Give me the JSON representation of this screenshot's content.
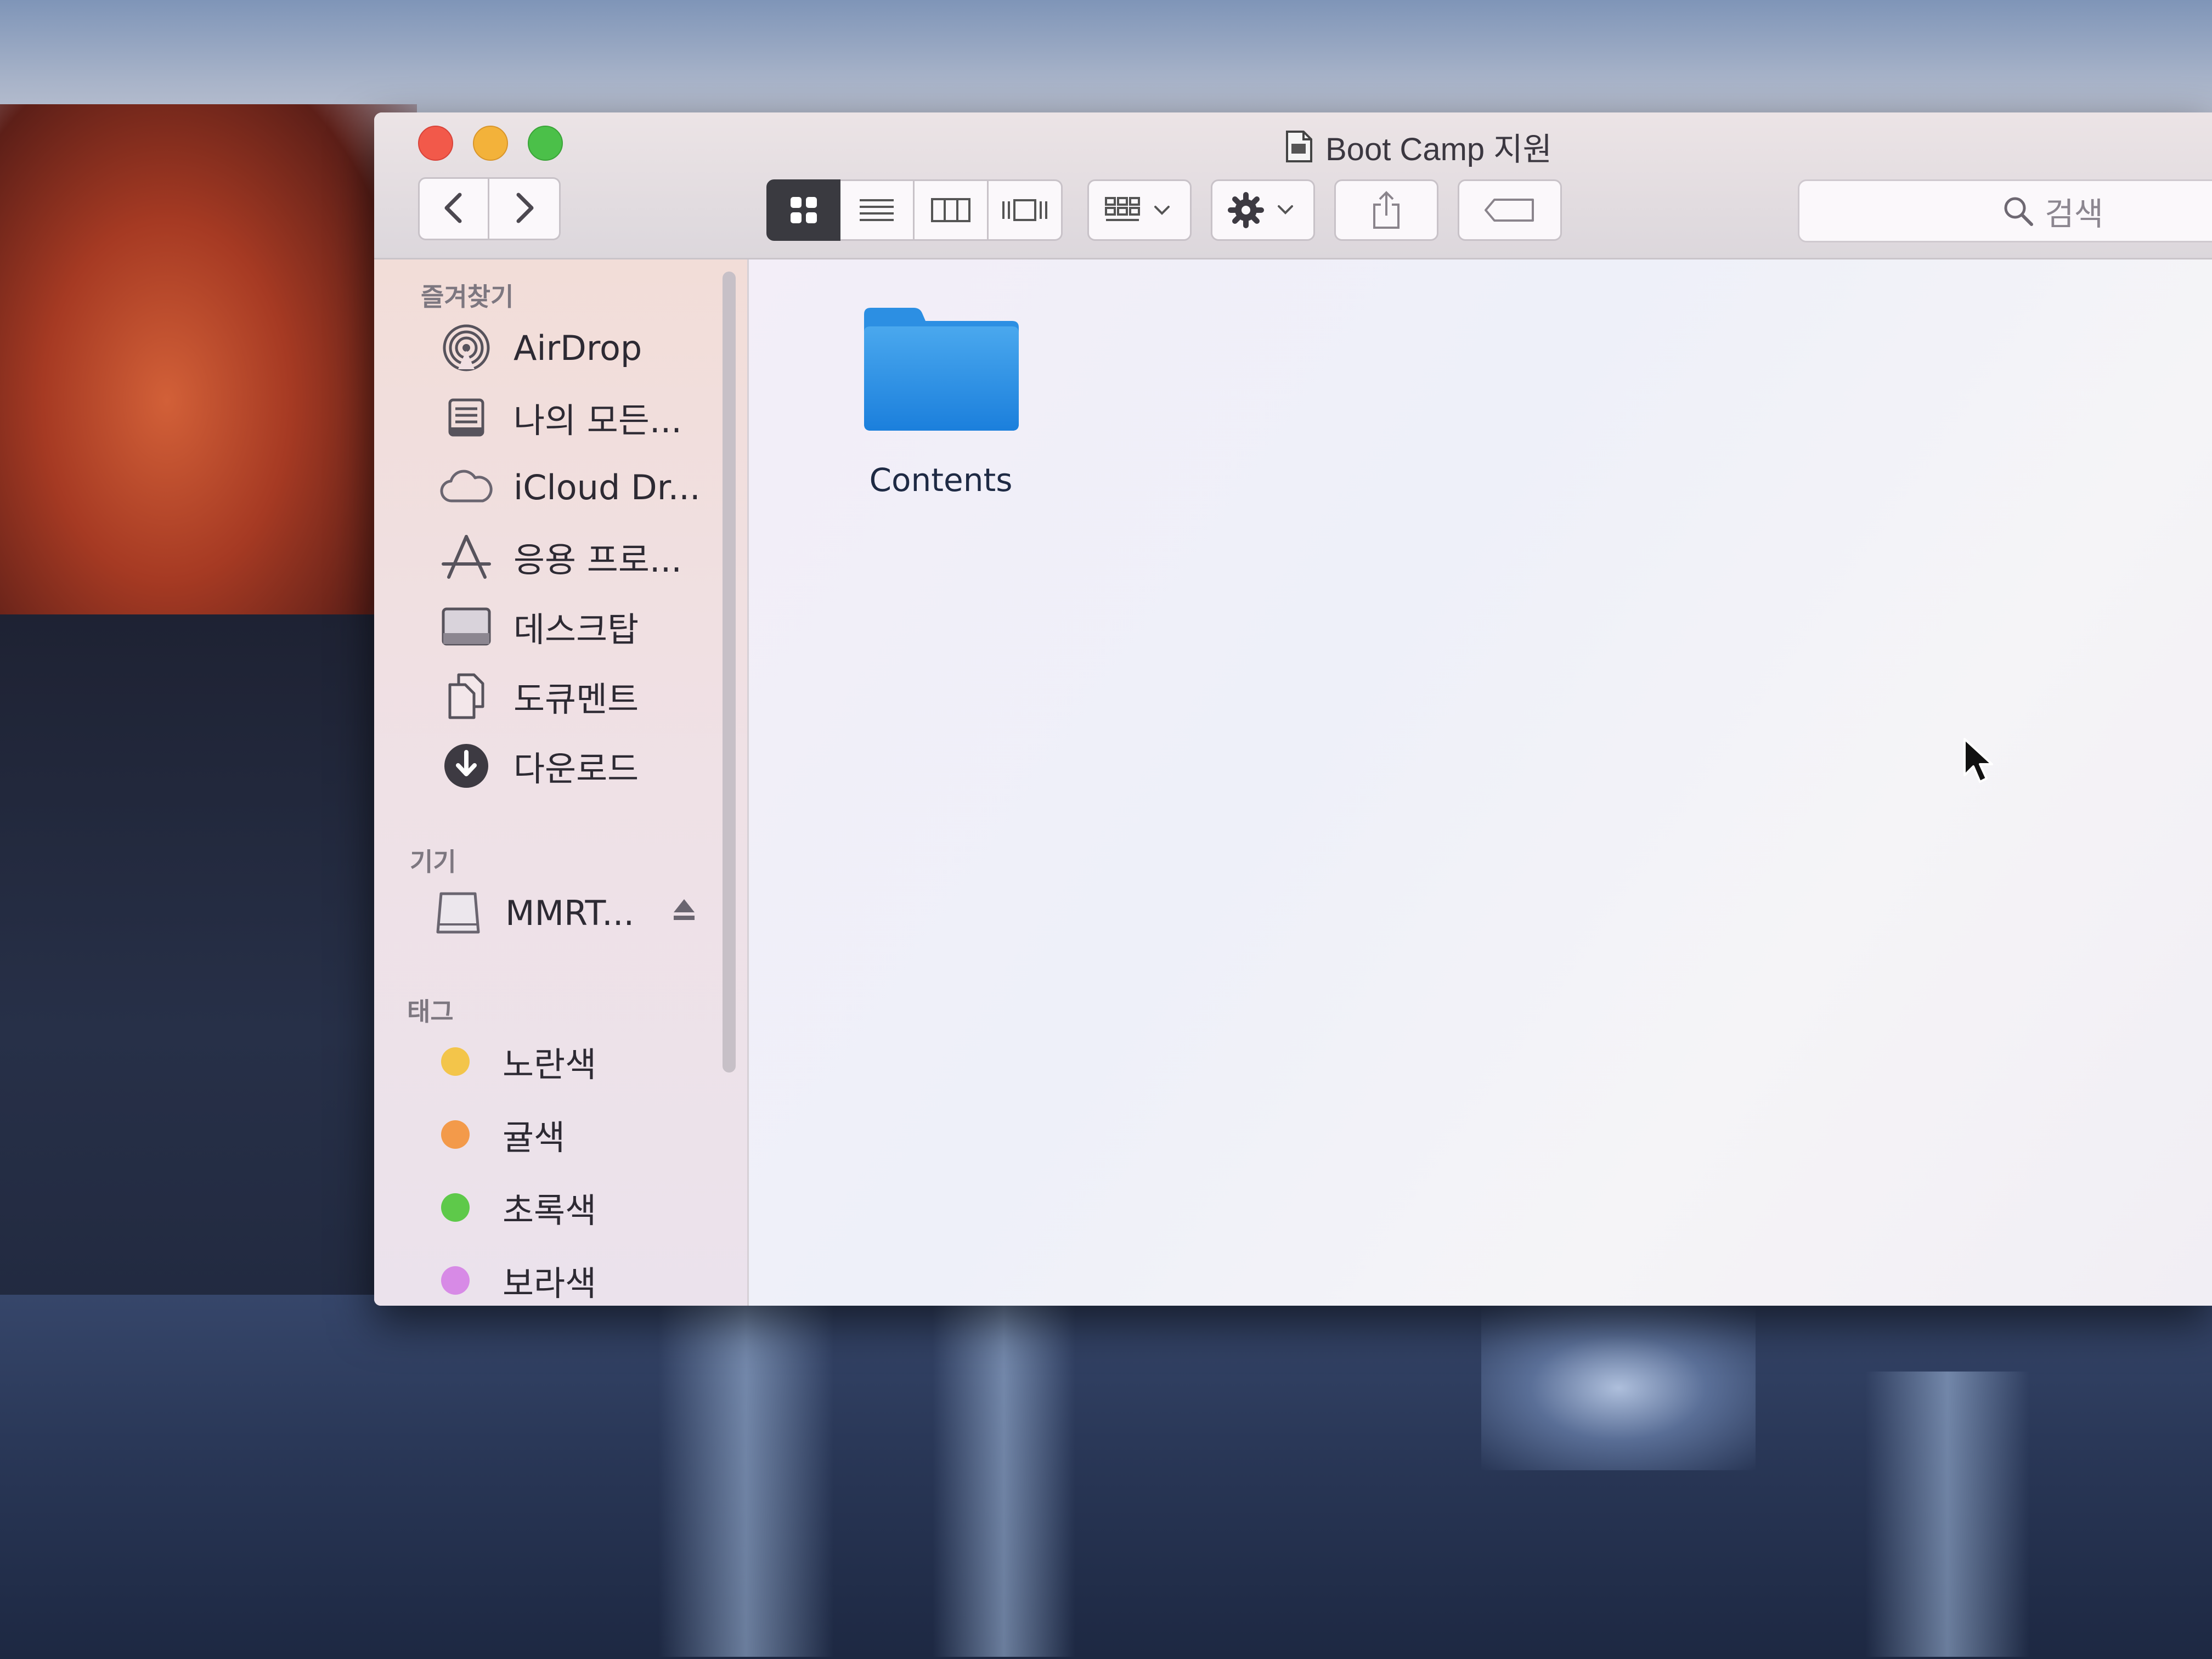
{
  "window": {
    "title": "Boot Camp 지원"
  },
  "toolbar": {
    "back_icon": "chevron-left-icon",
    "forward_icon": "chevron-right-icon",
    "view_modes": [
      "icon-view",
      "list-view",
      "column-view",
      "cover-flow-view"
    ],
    "search_placeholder": "검색"
  },
  "sidebar": {
    "favorites_header": "즐겨찾기",
    "favorites": [
      {
        "label": "AirDrop",
        "icon": "airdrop-icon"
      },
      {
        "label": "나의 모든...",
        "icon": "all-my-files-icon"
      },
      {
        "label": "iCloud Dr...",
        "icon": "cloud-icon"
      },
      {
        "label": "응용 프로...",
        "icon": "applications-icon"
      },
      {
        "label": "데스크탑",
        "icon": "desktop-icon"
      },
      {
        "label": "도큐멘트",
        "icon": "documents-icon"
      },
      {
        "label": "다운로드",
        "icon": "downloads-icon"
      }
    ],
    "devices_header": "기기",
    "devices": [
      {
        "label": "MMRT...",
        "icon": "drive-icon"
      }
    ],
    "tags_header": "태그",
    "tags": [
      {
        "label": "노란색",
        "color": "#f3c54a"
      },
      {
        "label": "귤색",
        "color": "#f39a4a"
      },
      {
        "label": "초록색",
        "color": "#5ec94a"
      },
      {
        "label": "보라색",
        "color": "#d78ae6"
      }
    ]
  },
  "content": {
    "items": [
      {
        "name": "Contents",
        "icon": "folder-icon"
      }
    ]
  }
}
